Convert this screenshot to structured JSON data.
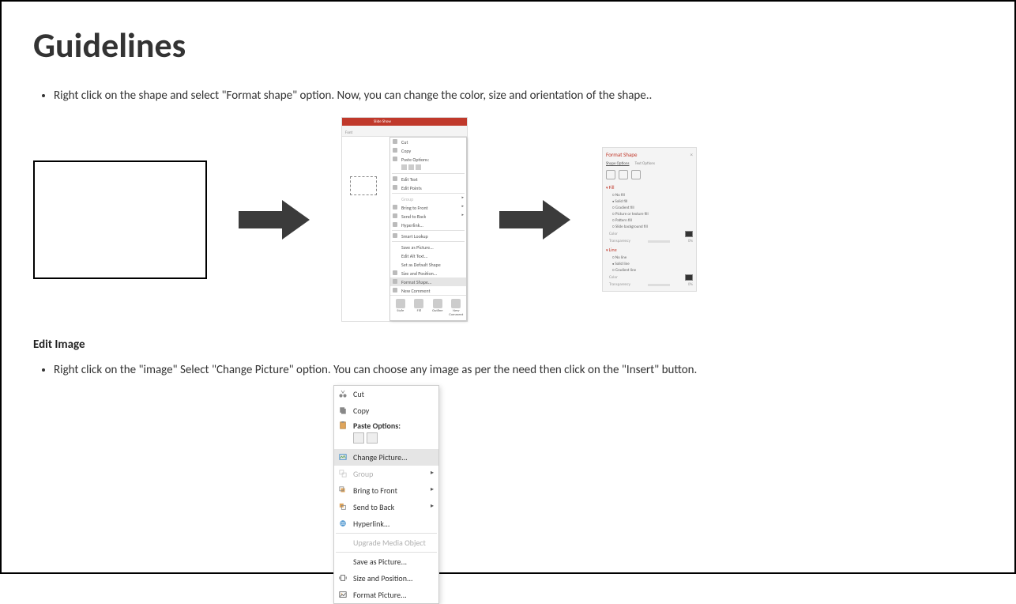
{
  "title": "Guidelines",
  "bullet1": "Right click on the shape and select \"Format shape\" option. Now, you can change the color, size and orientation of the shape..",
  "subhead": "Edit Image",
  "bullet2": "Right click on the \"image\" Select \"Change Picture\" option. You can choose any image as per the need then click on the \"Insert\" button.",
  "ribbon_tab": "Slide Show",
  "ribbon_group": "Font",
  "ctx1": {
    "cut": "Cut",
    "copy": "Copy",
    "paste_options": "Paste Options:",
    "edit_text": "Edit Text",
    "edit_points": "Edit Points",
    "group": "Group",
    "bring_to_front": "Bring to Front",
    "send_to_back": "Send to Back",
    "hyperlink": "Hyperlink...",
    "smart_lookup": "Smart Lookup",
    "save_as_picture": "Save as Picture...",
    "edit_alt_text": "Edit Alt Text...",
    "set_as_default": "Set as Default Shape",
    "size_and_position": "Size and Position...",
    "format_shape": "Format Shape...",
    "new_comment": "New Comment",
    "mini_style": "Style",
    "mini_fill": "Fill",
    "mini_outline": "Outline",
    "mini_new_comment": "New Comment"
  },
  "fs": {
    "title": "Format Shape",
    "shape_options": "Shape Options",
    "text_options": "Text Options",
    "fill": "Fill",
    "no_fill": "No fill",
    "solid_fill": "Solid fill",
    "gradient_fill": "Gradient fill",
    "picture_texture_fill": "Picture or texture fill",
    "pattern_fill": "Pattern fill",
    "slide_background_fill": "Slide background fill",
    "color": "Color",
    "transparency": "Transparency",
    "transparency_val": "0%",
    "line": "Line",
    "no_line": "No line",
    "solid_line": "Solid line",
    "gradient_line": "Gradient line"
  },
  "ctx2": {
    "cut": "Cut",
    "copy": "Copy",
    "paste_options": "Paste Options:",
    "change_picture": "Change Picture...",
    "group": "Group",
    "bring_to_front": "Bring to Front",
    "send_to_back": "Send to Back",
    "hyperlink": "Hyperlink...",
    "upgrade_media": "Upgrade Media Object",
    "save_as_picture": "Save as Picture...",
    "size_and_position": "Size and Position...",
    "format_picture": "Format Picture..."
  }
}
